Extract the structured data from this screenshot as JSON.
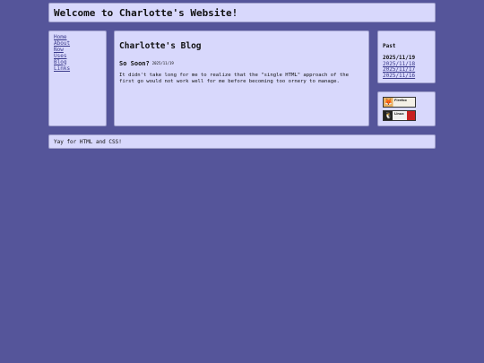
{
  "header": {
    "title": "Welcome to Charlotte's Website!"
  },
  "nav": {
    "items": [
      "Home",
      "About",
      "Now",
      "Uses",
      "Blog",
      "Links"
    ]
  },
  "main": {
    "blog_title": "Charlotte's Blog",
    "post": {
      "title": "So Soon?",
      "date": "2025/11/19",
      "body": "It didn't take long for me to realize that the \"single HTML\" approach of the first go would not work well for me before becoming too ornery to manage."
    }
  },
  "past": {
    "heading": "Past",
    "dates": [
      "2025/11/19",
      "2025/11/18",
      "2025/11/17",
      "2025/11/16"
    ]
  },
  "badges": {
    "firefox": {
      "label": "Firefox",
      "icon": "firefox-icon"
    },
    "linux": {
      "label": "Linux",
      "icon": "linux-tux-icon"
    }
  },
  "footer": {
    "text": "Yay for HTML and CSS!"
  },
  "colors": {
    "background": "#55559a",
    "panel": "#d8d8fc",
    "link": "#3a3a8a"
  }
}
